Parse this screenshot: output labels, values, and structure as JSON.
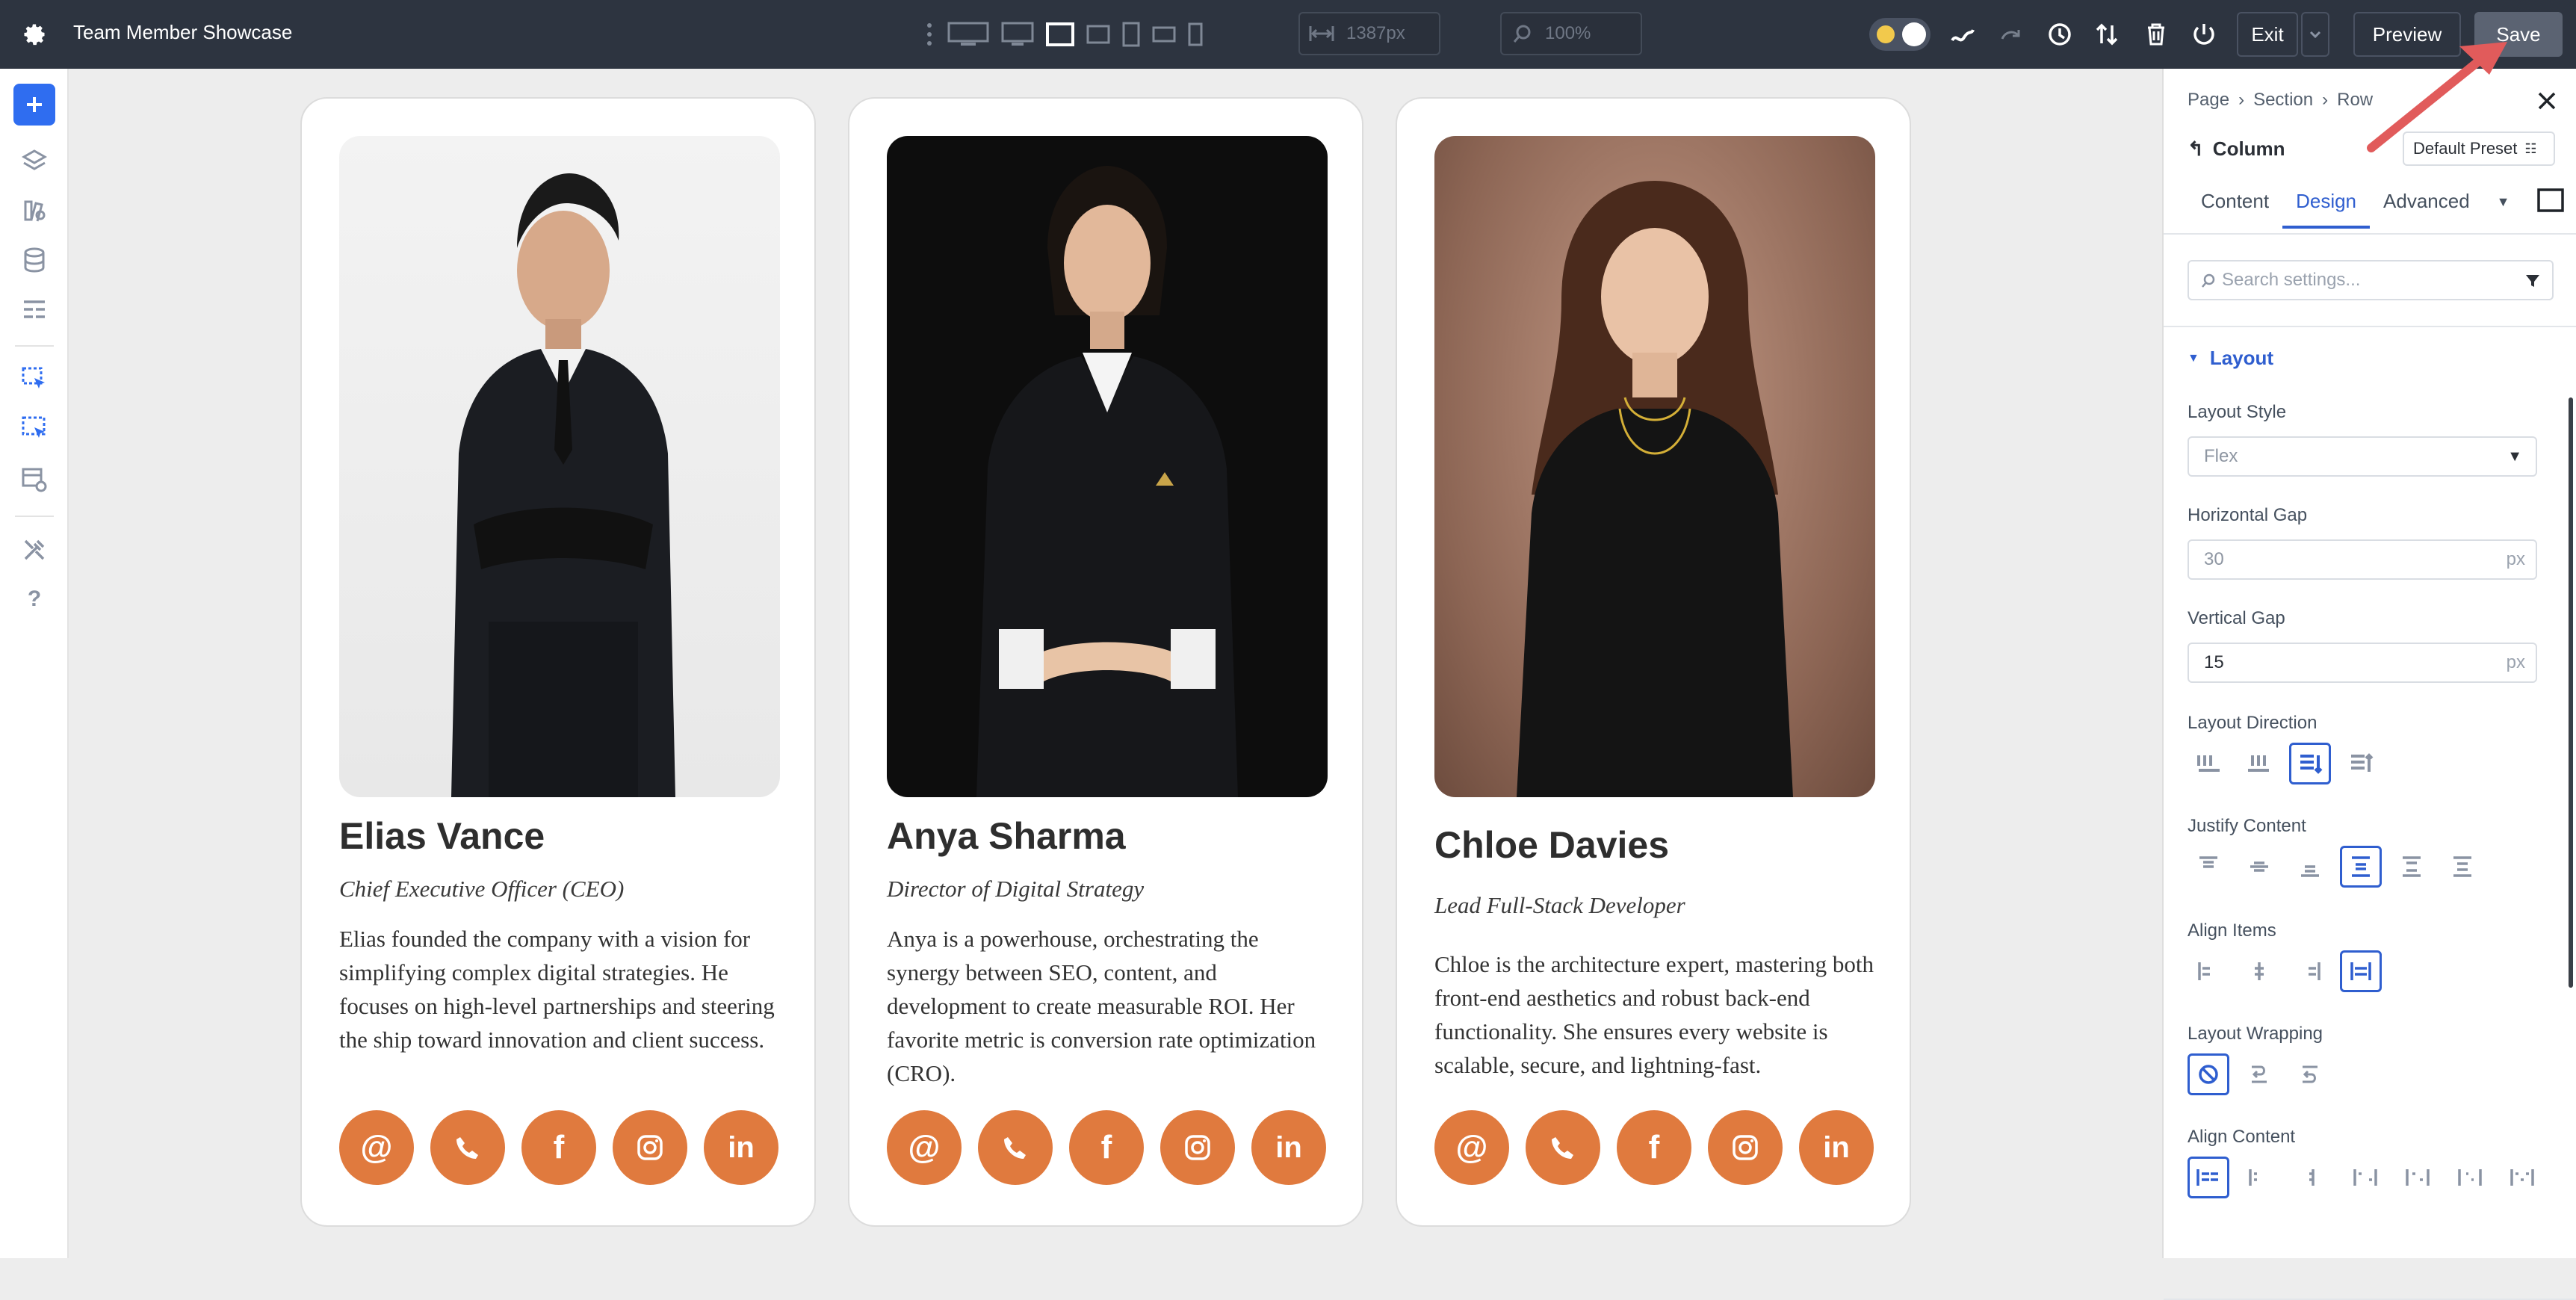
{
  "app": {
    "title": "Team Member Showcase"
  },
  "topbar": {
    "width_value": "1387px",
    "zoom_value": "100%",
    "exit_label": "Exit",
    "preview_label": "Preview",
    "save_label": "Save"
  },
  "cards": [
    {
      "name": "Elias Vance",
      "role": "Chief Executive Officer (CEO)",
      "bio": "Elias founded the company with a vision for simplifying complex digital strategies. He focuses on high-level partnerships and steering the ship toward innovation and client success."
    },
    {
      "name": "Anya Sharma",
      "role": "Director of Digital Strategy",
      "bio": "Anya is a powerhouse, orchestrating the synergy between SEO, content, and development to create measurable ROI. Her favorite metric is conversion rate optimization (CRO)."
    },
    {
      "name": "Chloe Davies",
      "role": "Lead Full-Stack Developer",
      "bio": "Chloe is the architecture expert, mastering both front-end aesthetics and robust back-end functionality. She ensures every website is scalable, secure, and lightning-fast."
    }
  ],
  "social_icons": [
    "email-icon",
    "phone-icon",
    "facebook-icon",
    "instagram-icon",
    "linkedin-icon"
  ],
  "panel": {
    "breadcrumb": [
      "Page",
      "Section",
      "Row"
    ],
    "element": "Column",
    "preset": "Default Preset",
    "tabs": [
      "Content",
      "Design",
      "Advanced"
    ],
    "active_tab": "Design",
    "search_placeholder": "Search settings...",
    "section": "Layout",
    "layout_style_label": "Layout Style",
    "layout_style_value": "Flex",
    "hgap_label": "Horizontal Gap",
    "hgap_value": "30",
    "vgap_label": "Vertical Gap",
    "vgap_value": "15",
    "unit": "px",
    "direction_label": "Layout Direction",
    "justify_label": "Justify Content",
    "align_items_label": "Align Items",
    "wrapping_label": "Layout Wrapping",
    "align_content_label": "Align Content"
  },
  "colors": {
    "accent": "#2f5ecf",
    "social": "#e07a3e",
    "topbar": "#2d3440"
  }
}
